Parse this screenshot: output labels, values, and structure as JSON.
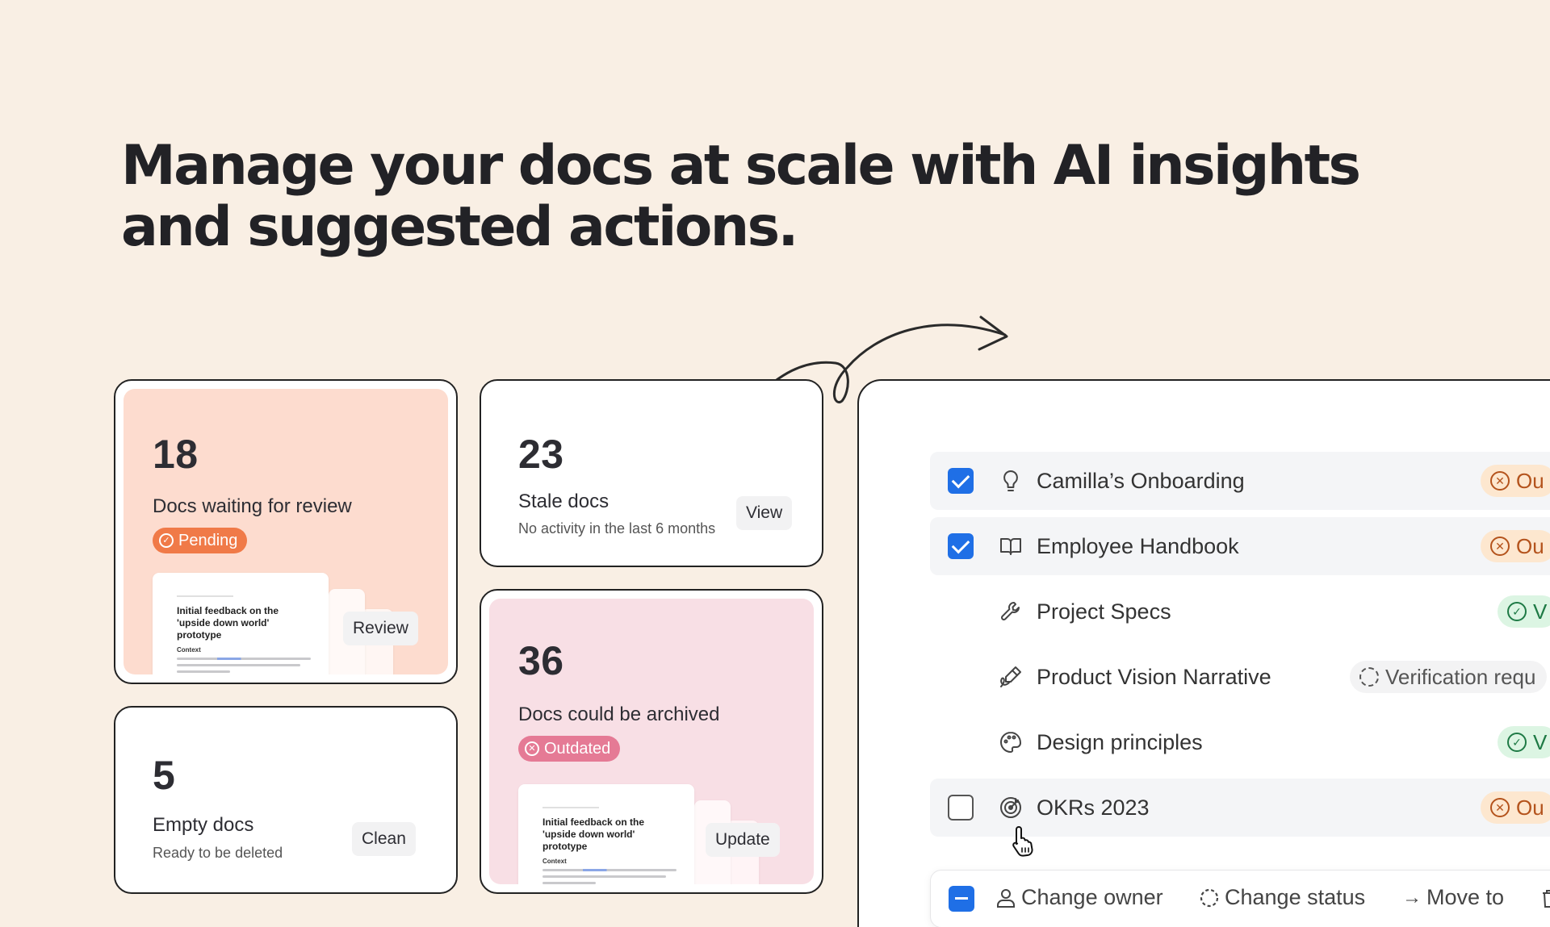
{
  "headline": {
    "line1": "Manage your docs at scale with AI insights",
    "line2": "and suggested actions."
  },
  "cards": {
    "review": {
      "count": "18",
      "title": "Docs waiting for review",
      "badge": "Pending",
      "action": "Review",
      "bg": "#fddccf",
      "badge_color": "#f07a48"
    },
    "stale": {
      "count": "23",
      "title": "Stale docs",
      "subtitle": "No activity in the last 6 months",
      "action": "View"
    },
    "archive": {
      "count": "36",
      "title": "Docs could be archived",
      "badge": "Outdated",
      "action": "Update",
      "bg": "#f8dfe5",
      "badge_color": "#e57a95"
    },
    "empty": {
      "count": "5",
      "title": "Empty docs",
      "subtitle": "Ready to be deleted",
      "action": "Clean"
    }
  },
  "doc_preview": {
    "title": "Initial feedback on the 'upside down world' prototype",
    "section": "Context"
  },
  "doc_list": {
    "rows": [
      {
        "label": "Camilla’s Onboarding",
        "icon": "lightbulb-icon",
        "checked": "checked",
        "status": "Ou",
        "status_type": "outdated"
      },
      {
        "label": "Employee Handbook",
        "icon": "book-icon",
        "checked": "checked",
        "status": "Ou",
        "status_type": "outdated"
      },
      {
        "label": "Project Specs",
        "icon": "wrench-icon",
        "checked": "none",
        "status": "V",
        "status_type": "verified"
      },
      {
        "label": "Product Vision Narrative",
        "icon": "signature-icon",
        "checked": "none",
        "status": "Verification requ",
        "status_type": "request"
      },
      {
        "label": "Design principles",
        "icon": "palette-icon",
        "checked": "none",
        "status": "V",
        "status_type": "verified"
      },
      {
        "label": "OKRs 2023",
        "icon": "target-icon",
        "checked": "empty",
        "status": "Ou",
        "status_type": "outdated"
      }
    ]
  },
  "action_bar": {
    "change_owner": "Change owner",
    "change_status": "Change status",
    "move_to": "Move to"
  },
  "colors": {
    "background": "#f9efe4",
    "accent_blue": "#1f6fe6",
    "outdated": "#b4531c",
    "verified": "#1e7a45"
  }
}
